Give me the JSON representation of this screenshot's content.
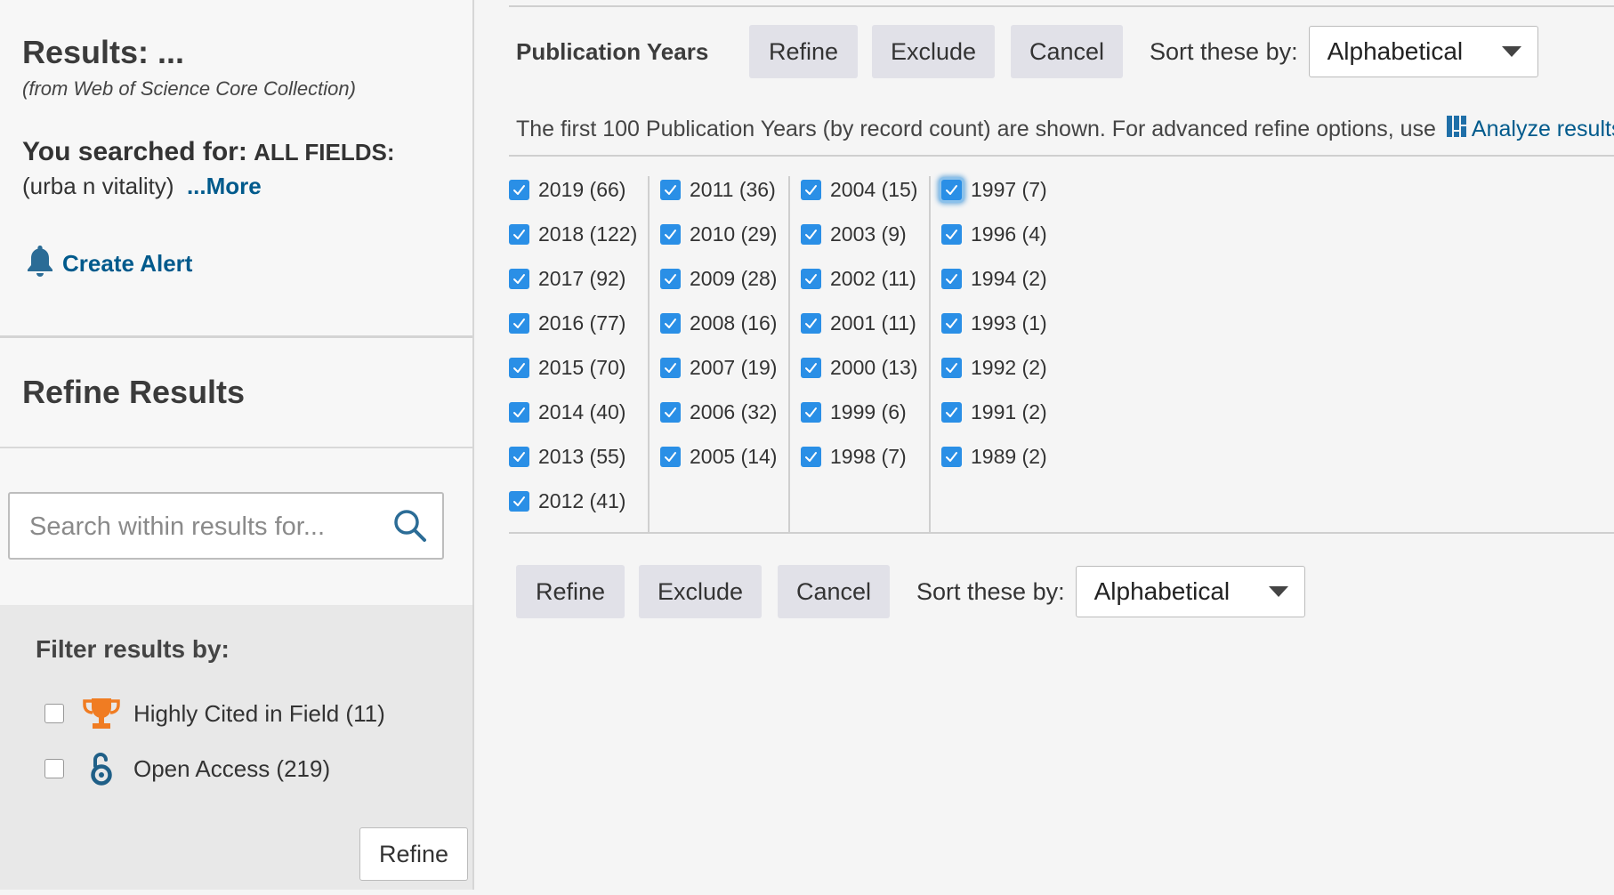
{
  "sidebar": {
    "results_title": "Results: ...",
    "results_subtitle": "(from Web of Science Core Collection)",
    "searched_label": "You searched for:",
    "searched_category": "ALL FIELDS:",
    "searched_query": " (urba n vitality)",
    "more_link": "...More",
    "create_alert": "Create Alert",
    "refine_title": "Refine Results",
    "search_placeholder": "Search within results for...",
    "filter_title": "Filter results by:",
    "filters": [
      {
        "label": "Highly Cited in Field (11)",
        "icon": "trophy-icon",
        "checked": false
      },
      {
        "label": "Open Access (219)",
        "icon": "open-access-icon",
        "checked": false
      }
    ],
    "refine_button": "Refine"
  },
  "main": {
    "section_title": "Publication Years",
    "buttons": {
      "refine": "Refine",
      "exclude": "Exclude",
      "cancel": "Cancel"
    },
    "sort_label": "Sort these by:",
    "sort_value": "Alphabetical",
    "info_text": "The first 100 Publication Years (by record count) are shown. For advanced refine options, use",
    "analyze_link": "Analyze results",
    "info_suffix": ".",
    "years": [
      [
        {
          "label": "2019 (66)",
          "checked": true
        },
        {
          "label": "2018 (122)",
          "checked": true
        },
        {
          "label": "2017 (92)",
          "checked": true
        },
        {
          "label": "2016 (77)",
          "checked": true
        },
        {
          "label": "2015 (70)",
          "checked": true
        },
        {
          "label": "2014 (40)",
          "checked": true
        },
        {
          "label": "2013 (55)",
          "checked": true
        },
        {
          "label": "2012 (41)",
          "checked": true
        }
      ],
      [
        {
          "label": "2011 (36)",
          "checked": true
        },
        {
          "label": "2010 (29)",
          "checked": true
        },
        {
          "label": "2009 (28)",
          "checked": true
        },
        {
          "label": "2008 (16)",
          "checked": true
        },
        {
          "label": "2007 (19)",
          "checked": true
        },
        {
          "label": "2006 (32)",
          "checked": true
        },
        {
          "label": "2005 (14)",
          "checked": true
        }
      ],
      [
        {
          "label": "2004 (15)",
          "checked": true
        },
        {
          "label": "2003 (9)",
          "checked": true
        },
        {
          "label": "2002 (11)",
          "checked": true
        },
        {
          "label": "2001 (11)",
          "checked": true
        },
        {
          "label": "2000 (13)",
          "checked": true
        },
        {
          "label": "1999 (6)",
          "checked": true
        },
        {
          "label": "1998 (7)",
          "checked": true
        }
      ],
      [
        {
          "label": "1997 (7)",
          "checked": true,
          "focused": true
        },
        {
          "label": "1996 (4)",
          "checked": true
        },
        {
          "label": "1994 (2)",
          "checked": true
        },
        {
          "label": "1993 (1)",
          "checked": true
        },
        {
          "label": "1992 (2)",
          "checked": true
        },
        {
          "label": "1991 (2)",
          "checked": true
        },
        {
          "label": "1989 (2)",
          "checked": true
        }
      ]
    ]
  },
  "colors": {
    "link": "#005a8c",
    "checkbox": "#2a8fe6",
    "trophy": "#f07c22"
  }
}
